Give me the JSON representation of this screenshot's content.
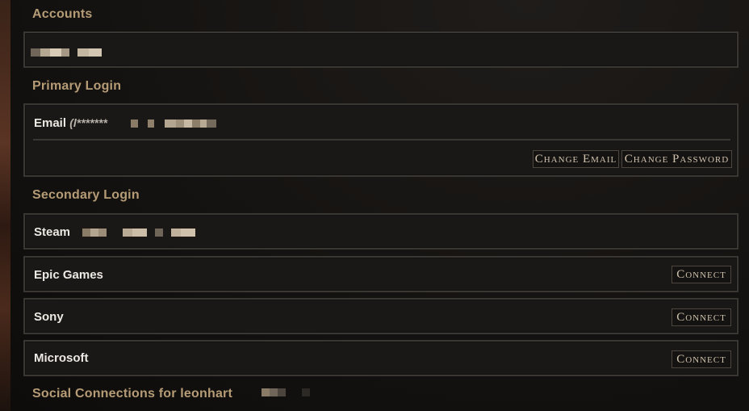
{
  "sections": {
    "accounts_title": "Accounts",
    "primary_login_title": "Primary Login",
    "secondary_login_title": "Secondary Login",
    "social_title": "Social Connections for leonhart"
  },
  "primary": {
    "email_label": "Email",
    "email_masked": "(l*******",
    "change_email_label": "Change Email",
    "change_password_label": "Change Password"
  },
  "secondary": {
    "steam_label": "Steam",
    "epic_label": "Epic Games",
    "sony_label": "Sony",
    "microsoft_label": "Microsoft",
    "connect_label": "Connect"
  },
  "colors": {
    "section_title": "#b59c76",
    "card_border": "#3a3632",
    "button_text": "#cfc2ae",
    "censor_tone": "#c8b8a0"
  }
}
